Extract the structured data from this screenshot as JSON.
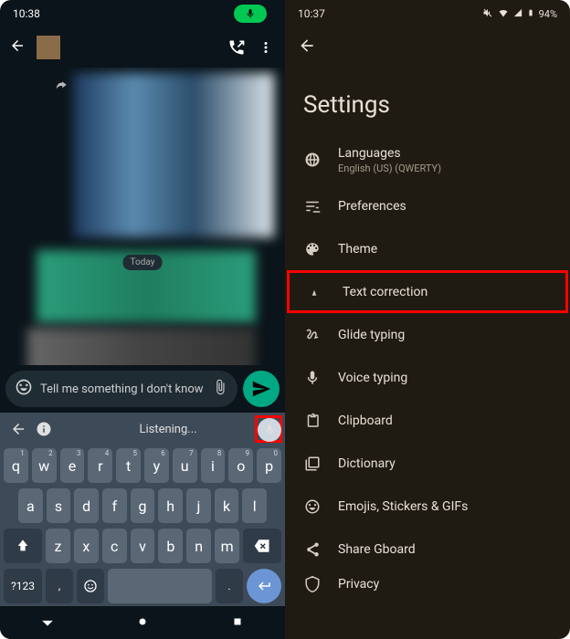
{
  "left": {
    "status": {
      "time": "10:38"
    },
    "chat": {
      "day_label": "Today",
      "input_text": "Tell me something I don't know"
    },
    "kbd": {
      "listening": "Listening...",
      "row1": [
        "q",
        "w",
        "e",
        "r",
        "t",
        "y",
        "u",
        "i",
        "o",
        "p"
      ],
      "row1sup": [
        "1",
        "2",
        "3",
        "4",
        "5",
        "6",
        "7",
        "8",
        "9",
        "0"
      ],
      "row2": [
        "a",
        "s",
        "d",
        "f",
        "g",
        "h",
        "j",
        "k",
        "l"
      ],
      "row3": [
        "z",
        "x",
        "c",
        "v",
        "b",
        "n",
        "m"
      ],
      "sym": "?123",
      "comma": ",",
      "period": "."
    }
  },
  "right": {
    "status": {
      "time": "10:37",
      "battery": "94%"
    },
    "title": "Settings",
    "items": [
      {
        "label": "Languages",
        "sub": "English (US) (QWERTY)"
      },
      {
        "label": "Preferences"
      },
      {
        "label": "Theme"
      },
      {
        "label": "Text correction"
      },
      {
        "label": "Glide typing"
      },
      {
        "label": "Voice typing"
      },
      {
        "label": "Clipboard"
      },
      {
        "label": "Dictionary"
      },
      {
        "label": "Emojis, Stickers & GIFs"
      },
      {
        "label": "Share Gboard"
      },
      {
        "label": "Privacy"
      }
    ]
  }
}
